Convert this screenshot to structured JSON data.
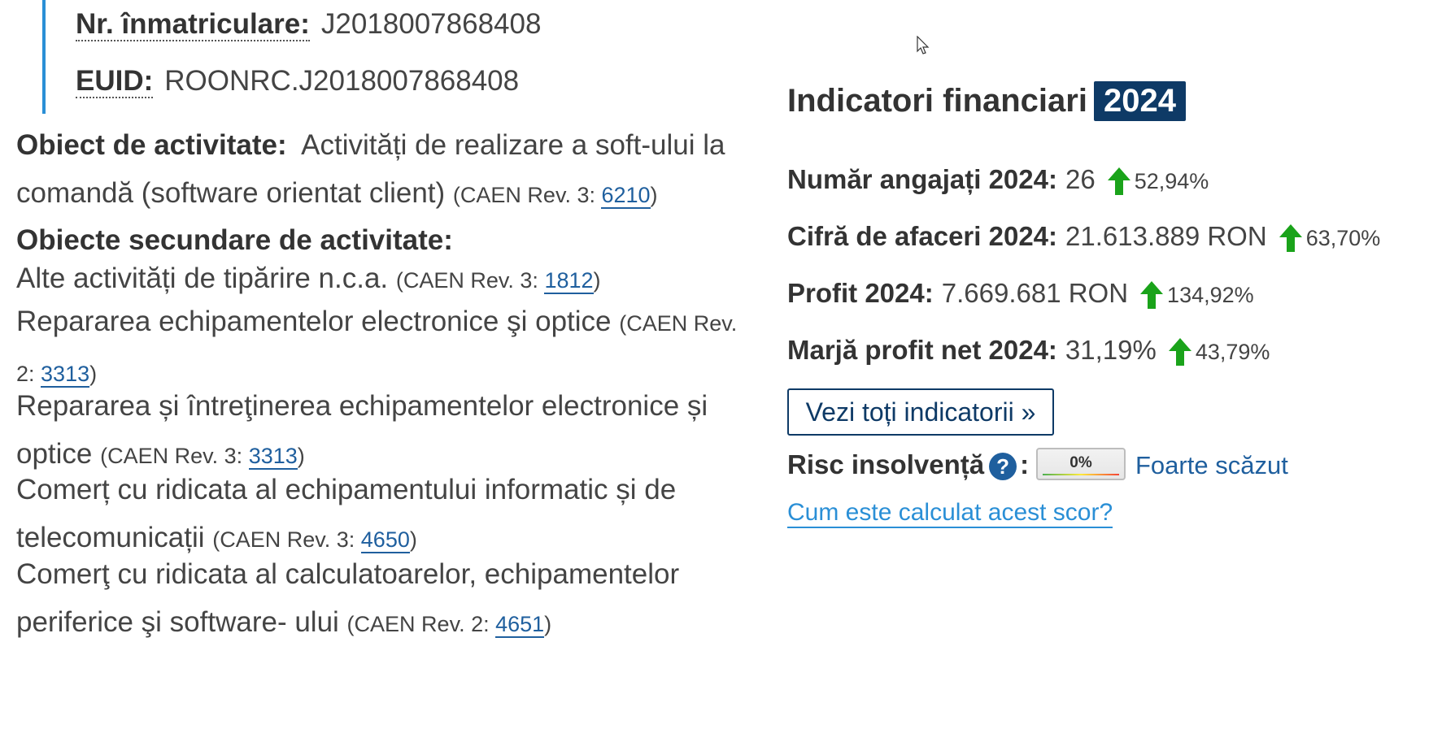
{
  "registration": {
    "nr_label": "Nr. înmatriculare:",
    "nr_value": "J2018007868408",
    "euid_label": "EUID:",
    "euid_value": "ROONRC.J2018007868408"
  },
  "activity": {
    "main_label": "Obiect de activitate:",
    "main_text": "Activități de realizare a soft-ului la comandă (software orientat client)",
    "main_caen_prefix": "(CAEN Rev. 3: ",
    "main_caen_code": "6210",
    "close": ")",
    "secondary_label": "Obiecte secundare de activitate:",
    "secondary": [
      {
        "text": "Alte activități de tipărire n.c.a.",
        "caen_prefix": "(CAEN Rev. 3: ",
        "code": "1812"
      },
      {
        "text": "Repararea echipamentelor electronice şi optice",
        "caen_prefix": "(CAEN Rev. 2: ",
        "code": "3313"
      },
      {
        "text": "Repararea și întreţinerea echipamentelor electronice și optice",
        "caen_prefix": "(CAEN Rev. 3: ",
        "code": "3313"
      },
      {
        "text": "Comerț cu ridicata al echipamentului informatic și de telecomunicații",
        "caen_prefix": "(CAEN Rev. 3: ",
        "code": "4650"
      },
      {
        "text": "Comerţ cu ridicata al calculatoarelor, echipamentelor periferice şi software- ului",
        "caen_prefix": "(CAEN Rev. 2: ",
        "code": "4651"
      }
    ]
  },
  "financial": {
    "title": "Indicatori financiari",
    "year": "2024",
    "indicators": [
      {
        "label": "Număr angajați 2024:",
        "value": "26",
        "change": "52,94%"
      },
      {
        "label": "Cifră de afaceri 2024:",
        "value": "21.613.889 RON",
        "change": "63,70%"
      },
      {
        "label": "Profit 2024:",
        "value": "7.669.681 RON",
        "change": "134,92%"
      },
      {
        "label": "Marjă profit net 2024:",
        "value": "31,19%",
        "change": "43,79%"
      }
    ],
    "view_all_label": "Vezi toți indicatorii »",
    "risk_label": "Risc insolvență",
    "risk_colon": ":",
    "risk_value": "0%",
    "risk_text": "Foarte scăzut",
    "calc_link": "Cum este calculat acest scor?"
  },
  "colors": {
    "accent": "#2a8fd6",
    "brand_dark": "#0e3a66",
    "link": "#1f5f9e",
    "up_arrow": "#1aa31a"
  },
  "icons": [
    "up-arrow-icon",
    "help-icon",
    "mouse-cursor-icon"
  ]
}
